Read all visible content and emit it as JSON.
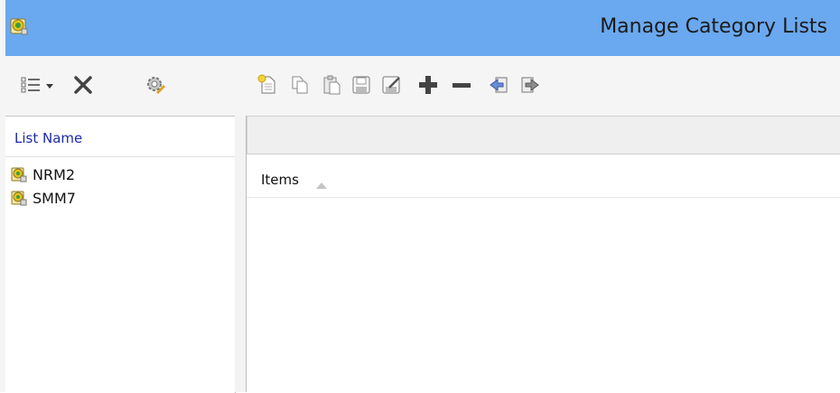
{
  "window": {
    "title": "Manage Category Lists"
  },
  "left_toolbar": [
    {
      "icon": "list-view-icon",
      "has_dropdown": true
    },
    {
      "icon": "delete-icon"
    },
    {
      "icon": "settings-edit-icon"
    }
  ],
  "right_toolbar": [
    {
      "icon": "new-document-icon"
    },
    {
      "icon": "copy-icon"
    },
    {
      "icon": "paste-icon"
    },
    {
      "icon": "save-icon"
    },
    {
      "icon": "save-as-icon"
    },
    {
      "icon": "add-icon"
    },
    {
      "icon": "remove-icon"
    },
    {
      "icon": "import-icon"
    },
    {
      "icon": "export-icon"
    }
  ],
  "left_panel": {
    "header": "List Name",
    "items": [
      {
        "label": "NRM2",
        "icon": "category-list-icon"
      },
      {
        "label": "SMM7",
        "icon": "category-list-icon"
      }
    ]
  },
  "right_panel": {
    "column_header": "Items",
    "sort": "ascending",
    "items": []
  },
  "colors": {
    "titlebar": "#6aa8ef",
    "header_text": "#1e2aa6"
  }
}
